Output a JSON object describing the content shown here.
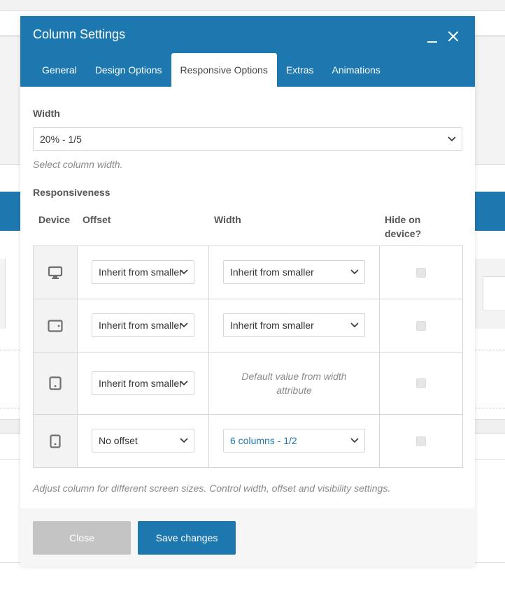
{
  "modal": {
    "title": "Column Settings"
  },
  "tabs": [
    {
      "label": "General"
    },
    {
      "label": "Design Options"
    },
    {
      "label": "Responsive Options",
      "active": true
    },
    {
      "label": "Extras"
    },
    {
      "label": "Animations"
    }
  ],
  "width": {
    "label": "Width",
    "value": "20% - 1/5",
    "help": "Select column width."
  },
  "responsiveness": {
    "label": "Responsiveness",
    "headers": {
      "device": "Device",
      "offset": "Offset",
      "width": "Width",
      "hide": "Hide on device?"
    },
    "rows": [
      {
        "device_icon": "desktop-icon",
        "offset": "Inherit from smaller",
        "width": "Inherit from smaller",
        "hidden": false
      },
      {
        "device_icon": "tablet-landscape-icon",
        "offset": "Inherit from smaller",
        "width": "Inherit from smaller",
        "hidden": false
      },
      {
        "device_icon": "tablet-portrait-icon",
        "offset": "Inherit from smaller",
        "width_note": "Default value from width attribute",
        "hidden": false
      },
      {
        "device_icon": "mobile-icon",
        "offset": "No offset",
        "width": "6 columns - 1/2",
        "hidden": false
      }
    ],
    "help": "Adjust column for different screen sizes. Control width, offset and visibility settings."
  },
  "footer": {
    "close_label": "Close",
    "save_label": "Save changes"
  },
  "colors": {
    "primary": "#1e78b0",
    "disabled_button": "#c4c4c4",
    "link_value": "#1e78b0"
  }
}
